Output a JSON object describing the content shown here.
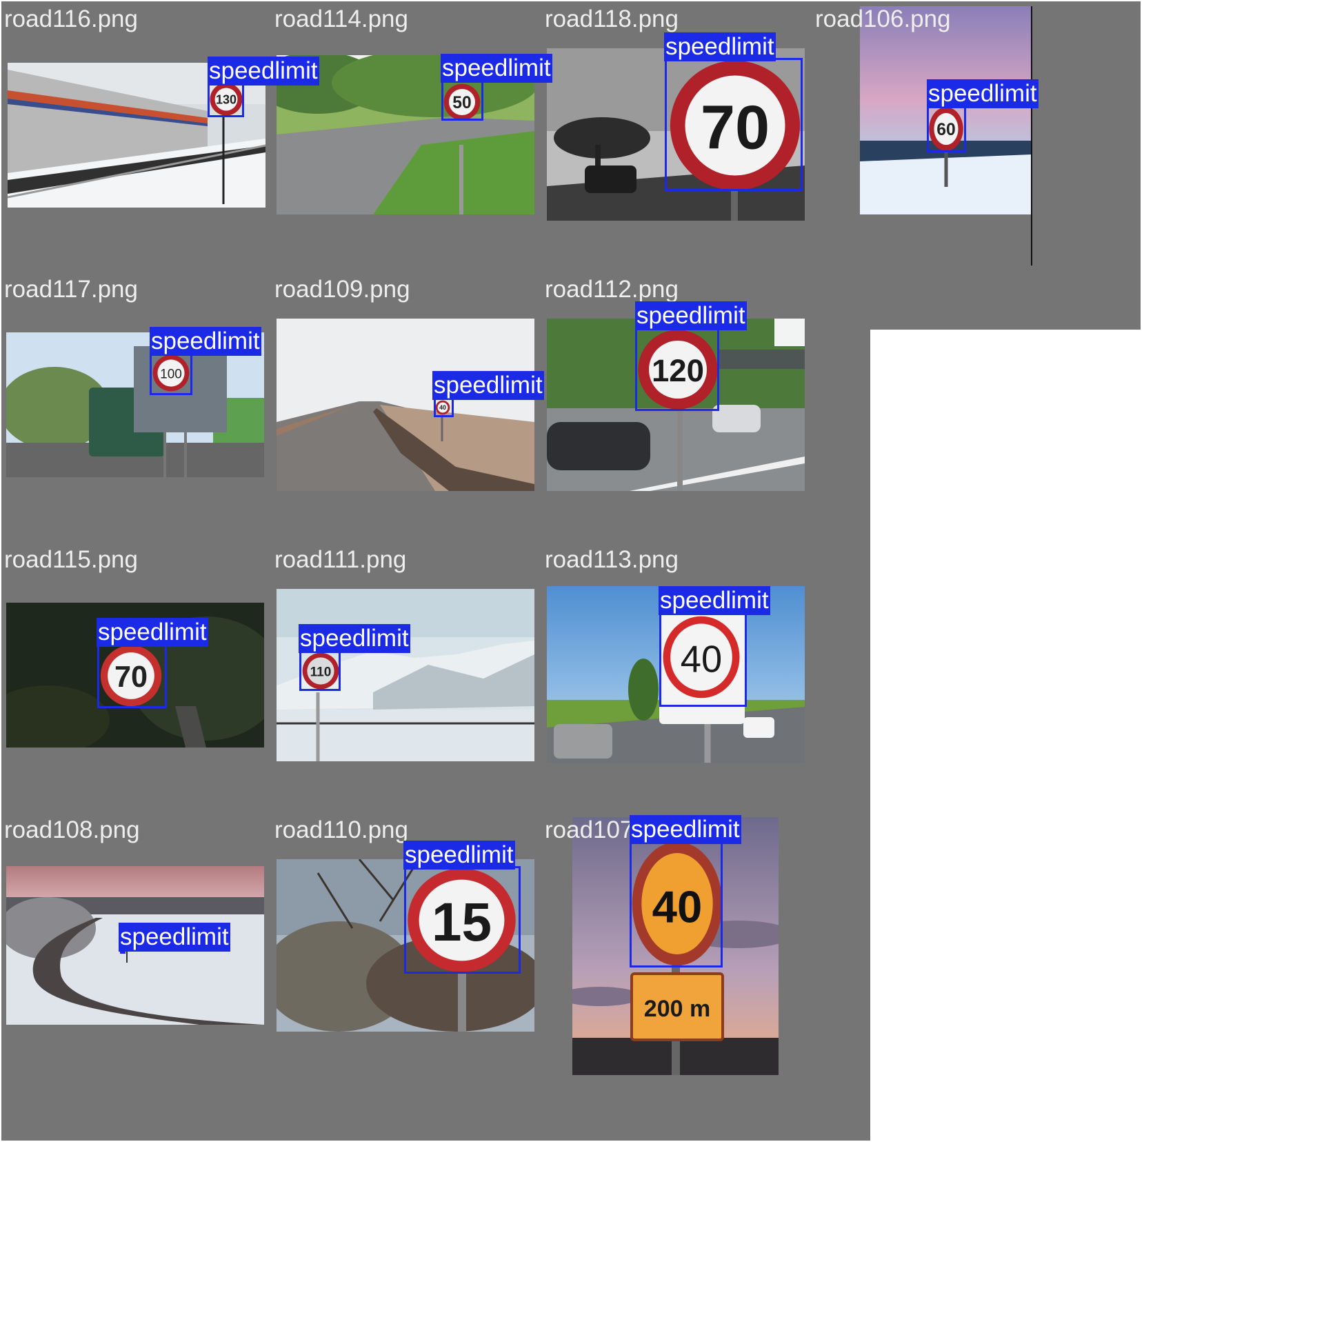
{
  "detection_label": "speedlimit",
  "box_color": "#1a2ae6",
  "cells": [
    {
      "file": "road116.png",
      "scene": "train-snow",
      "sign_text": "130",
      "sign_style": "red"
    },
    {
      "file": "road114.png",
      "scene": "country-road",
      "sign_text": "50",
      "sign_style": "red"
    },
    {
      "file": "road118.png",
      "scene": "bw-road",
      "sign_text": "70",
      "sign_style": "red"
    },
    {
      "file": "road106.png",
      "scene": "pink-snow",
      "sign_text": "60",
      "sign_style": "red"
    },
    {
      "file": "road117.png",
      "scene": "truck",
      "sign_text": "100",
      "sign_style": "red"
    },
    {
      "file": "road109.png",
      "scene": "foggy-road",
      "sign_text": "40",
      "sign_style": "red"
    },
    {
      "file": "road112.png",
      "scene": "highway",
      "sign_text": "120",
      "sign_style": "red"
    },
    {
      "file": "road115.png",
      "scene": "dark-grass",
      "sign_text": "70",
      "sign_style": "red"
    },
    {
      "file": "road111.png",
      "scene": "snow-mountains",
      "sign_text": "110",
      "sign_style": "red"
    },
    {
      "file": "road113.png",
      "scene": "sunny-road",
      "sign_text": "40",
      "sign_style": "red"
    },
    {
      "file": "road108.png",
      "scene": "dusk-snow-road",
      "sign_text": "",
      "sign_style": "none"
    },
    {
      "file": "road110.png",
      "scene": "trees-sky",
      "sign_text": "15",
      "sign_style": "red"
    },
    {
      "file": "road107.png",
      "scene": "dusk-sky",
      "sign_text": "40",
      "sign_style": "orange",
      "plate_text": "200 m"
    }
  ]
}
